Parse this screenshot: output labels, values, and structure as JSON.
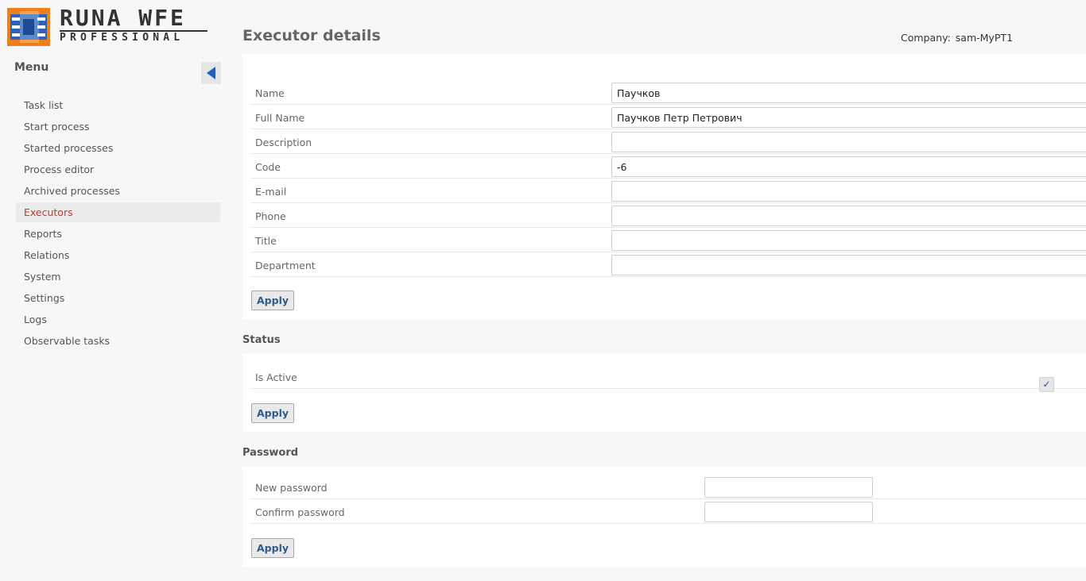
{
  "logo": {
    "title": "RUNA WFE",
    "subtitle": "PROFESSIONAL"
  },
  "sidebar": {
    "menu_title": "Menu",
    "items": [
      {
        "label": "Task list"
      },
      {
        "label": "Start process"
      },
      {
        "label": "Started processes"
      },
      {
        "label": "Process editor"
      },
      {
        "label": "Archived processes"
      },
      {
        "label": "Executors",
        "active": true
      },
      {
        "label": "Reports"
      },
      {
        "label": "Relations"
      },
      {
        "label": "System"
      },
      {
        "label": "Settings"
      },
      {
        "label": "Logs"
      },
      {
        "label": "Observable tasks"
      }
    ]
  },
  "header": {
    "title": "Executor details",
    "company_label": "Company:",
    "company_value": "sam-MyPT1"
  },
  "details": {
    "fields": [
      {
        "label": "Name",
        "value": "Паучков"
      },
      {
        "label": "Full Name",
        "value": "Паучков Петр Петрович"
      },
      {
        "label": "Description",
        "value": ""
      },
      {
        "label": "Code",
        "value": "-6"
      },
      {
        "label": "E-mail",
        "value": ""
      },
      {
        "label": "Phone",
        "value": ""
      },
      {
        "label": "Title",
        "value": ""
      },
      {
        "label": "Department",
        "value": ""
      }
    ],
    "apply_label": "Apply"
  },
  "status": {
    "heading": "Status",
    "is_active_label": "Is Active",
    "is_active_checked": true,
    "check_glyph": "✓",
    "apply_label": "Apply"
  },
  "password": {
    "heading": "Password",
    "new_label": "New password",
    "confirm_label": "Confirm password",
    "apply_label": "Apply"
  },
  "colors": {
    "active_menu": "#c0392b",
    "button_text": "#2f5d8a",
    "collapse_arrow": "#1f5fbf",
    "logo_blue": "#2a63b8",
    "logo_orange": "#f07f1a"
  },
  "icons": {
    "collapse": "triangle-left-icon",
    "logo": "runa-chip-logo-icon",
    "checkbox": "checkmark-icon"
  }
}
